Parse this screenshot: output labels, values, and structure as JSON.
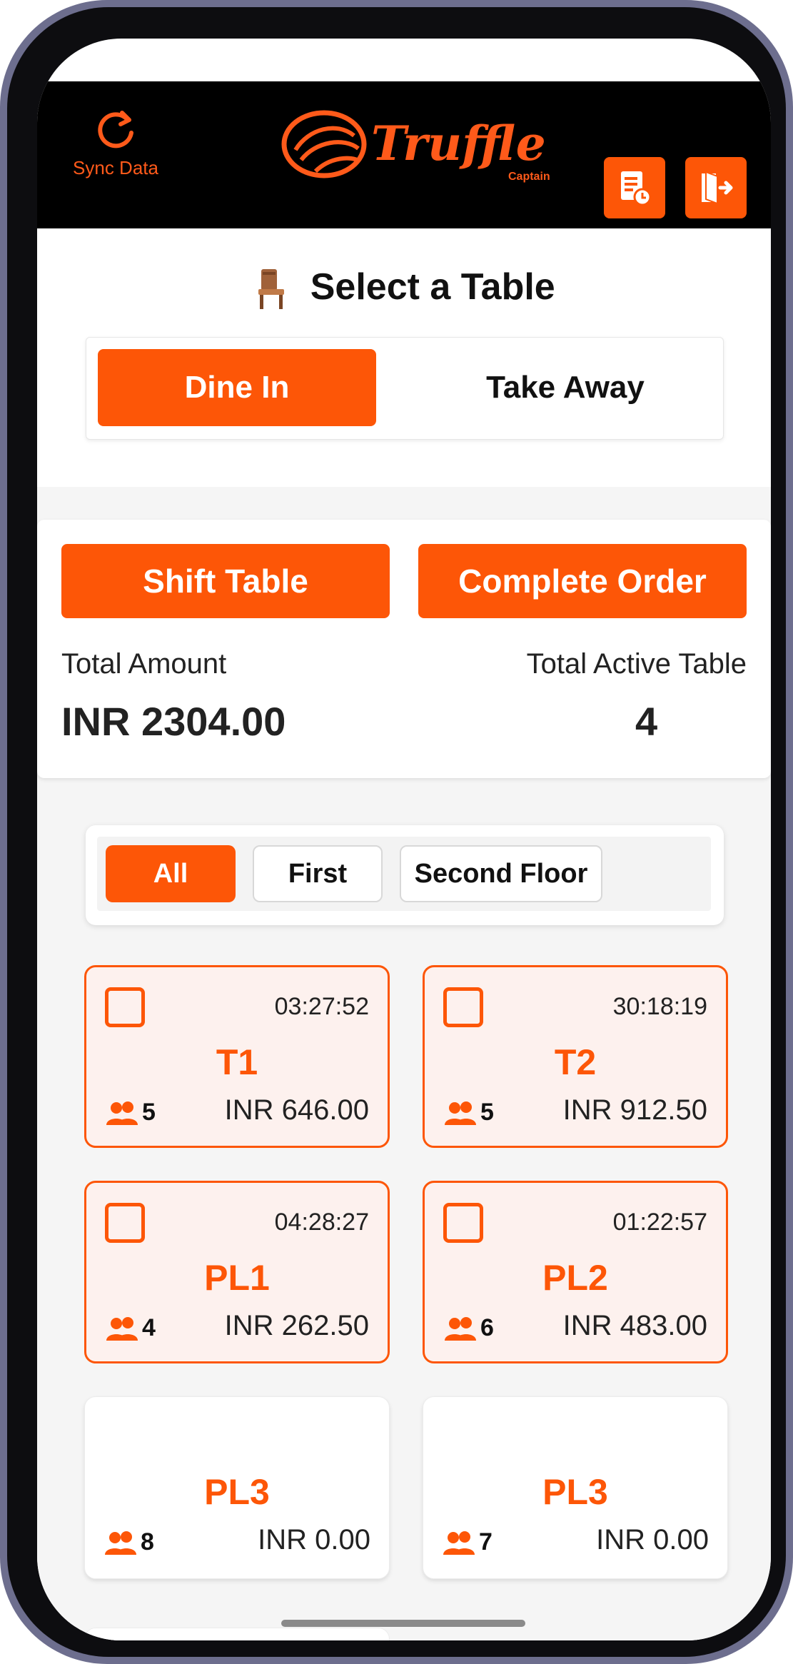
{
  "header": {
    "sync_label": "Sync Data",
    "logo_text": "Truffle",
    "logo_subtext": "Captain",
    "buttons": [
      {
        "icon": "report-clock-icon"
      },
      {
        "icon": "logout-door-icon"
      }
    ]
  },
  "page": {
    "title": "Select a Table",
    "title_icon": "chair-icon"
  },
  "order_type": {
    "options": [
      "Dine In",
      "Take Away"
    ],
    "selected": "Dine In"
  },
  "actions": {
    "shift_table": "Shift Table",
    "complete_order": "Complete Order"
  },
  "summary": {
    "total_amount_label": "Total Amount",
    "total_amount_value": "INR 2304.00",
    "active_tables_label": "Total Active Table",
    "active_tables_value": "4"
  },
  "floors": {
    "options": [
      "All",
      "First",
      "Second Floor"
    ],
    "selected": "All"
  },
  "tables": [
    {
      "name": "T1",
      "timer": "03:27:52",
      "guests": "5",
      "amount": "INR 646.00",
      "active": true
    },
    {
      "name": "T2",
      "timer": "30:18:19",
      "guests": "5",
      "amount": "INR 912.50",
      "active": true
    },
    {
      "name": "PL1",
      "timer": "04:28:27",
      "guests": "4",
      "amount": "INR 262.50",
      "active": true
    },
    {
      "name": "PL2",
      "timer": "01:22:57",
      "guests": "6",
      "amount": "INR 483.00",
      "active": true
    },
    {
      "name": "PL3",
      "timer": "",
      "guests": "8",
      "amount": "INR 0.00",
      "active": false
    },
    {
      "name": "PL3",
      "timer": "",
      "guests": "7",
      "amount": "INR 0.00",
      "active": false
    }
  ],
  "colors": {
    "accent": "#fd5607",
    "header_bg": "#000000",
    "active_card_bg": "#fdf1ee"
  }
}
